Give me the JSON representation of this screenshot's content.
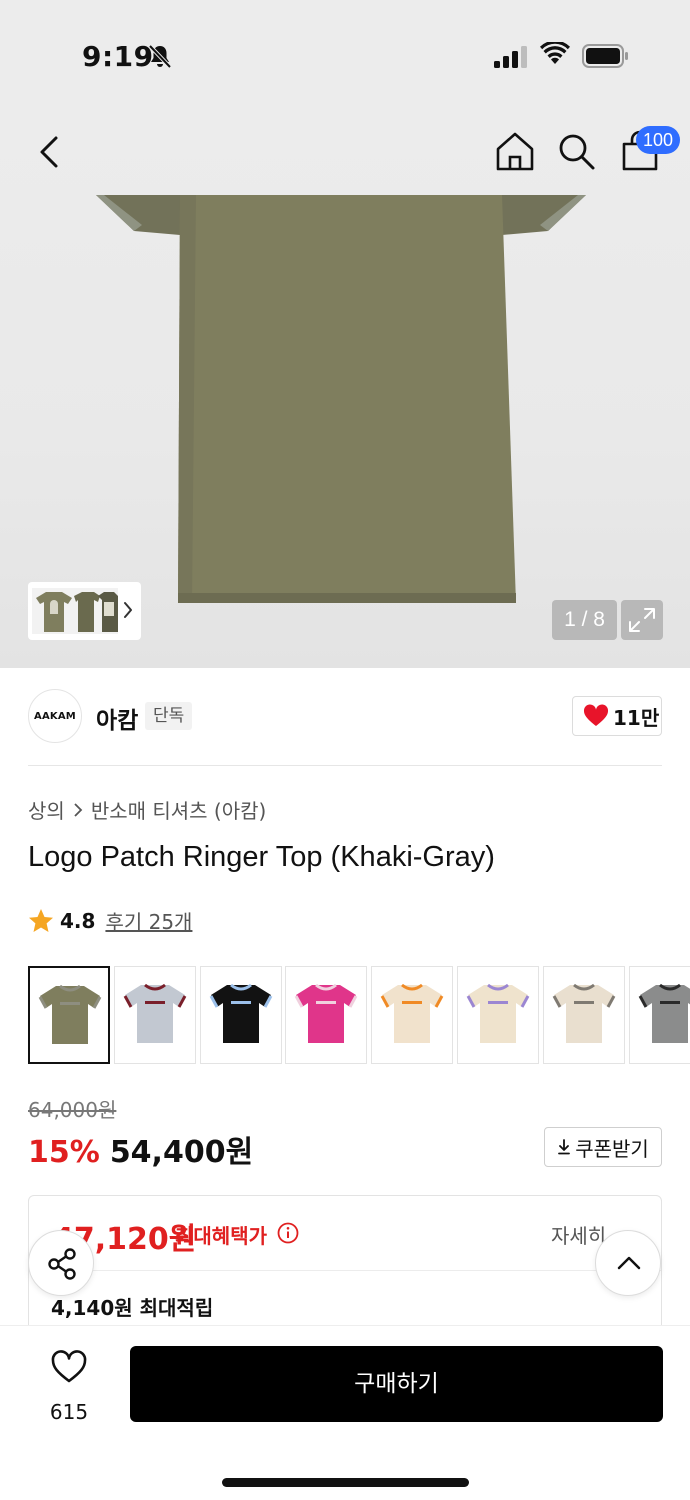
{
  "status_bar": {
    "time": "9:19"
  },
  "nav": {
    "cart_badge": "100"
  },
  "gallery": {
    "page_counter": "1 / 8"
  },
  "brand": {
    "logo_text": "AAKAM",
    "name": "아캄",
    "tag": "단독",
    "likes": "11만"
  },
  "breadcrumb": {
    "category": "상의",
    "subcategory": "반소매 티셔츠 (아캄)"
  },
  "product": {
    "title": "Logo Patch Ringer Top (Khaki-Gray)",
    "rating": "4.8",
    "reviews": "후기 25개"
  },
  "swatches": [
    {
      "body": "#7f7e5e",
      "trim": "#8e8e80",
      "selected": true
    },
    {
      "body": "#c2c8d1",
      "trim": "#7a1f2a",
      "selected": false
    },
    {
      "body": "#121212",
      "trim": "#9cc0ea",
      "selected": false
    },
    {
      "body": "#e0358a",
      "trim": "#f0d0de",
      "selected": false
    },
    {
      "body": "#f1e2cc",
      "trim": "#f08a25",
      "selected": false
    },
    {
      "body": "#efe3cd",
      "trim": "#9b86d2",
      "selected": false
    },
    {
      "body": "#e9dfcf",
      "trim": "#7f7a72",
      "selected": false
    },
    {
      "body": "#8b8c8c",
      "trim": "#2a2a2a",
      "selected": false
    }
  ],
  "pricing": {
    "original": "64,000원",
    "discount": "15%",
    "sale": "54,400원",
    "coupon_label": "쿠폰받기",
    "max_benefit_price": "47,120원",
    "max_benefit_label": "최대혜택가",
    "detail_label": "자세히",
    "points": "4,140원 최대적립"
  },
  "bottom_bar": {
    "wish_count": "615",
    "buy_label": "구매하기"
  },
  "colors": {
    "accent_red": "#e02020",
    "badge_blue": "#2f6dff",
    "shirt_khaki": "#7f7e5e"
  }
}
